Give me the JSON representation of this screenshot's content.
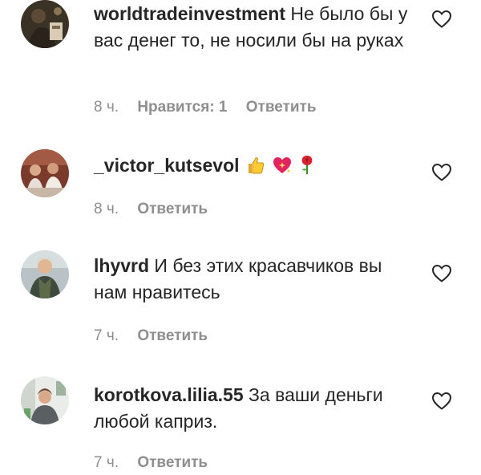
{
  "comments": [
    {
      "username": "worldtradeinvestment",
      "text": "Не было бы у вас денег то, не носили бы на руках",
      "time": "8 ч.",
      "likes_label": "Нравится: 1",
      "reply_label": "Ответить",
      "avatar_icon": "dark-photo-avatar"
    },
    {
      "username": "_victor_kutsevol",
      "text": "",
      "emojis": [
        "thumbs-up-icon",
        "sparkling-heart-icon",
        "rose-icon"
      ],
      "time": "8 ч.",
      "reply_label": "Ответить",
      "avatar_icon": "group-photo-avatar"
    },
    {
      "username": "lhyvrd",
      "text": "И без этих красавчиков вы нам нравитесь",
      "time": "7 ч.",
      "reply_label": "Ответить",
      "avatar_icon": "woman-photo-avatar"
    },
    {
      "username": "korotkova.lilia.55",
      "text": "За ваши деньги любой каприз.",
      "time": "7 ч.",
      "reply_label": "Ответить",
      "avatar_icon": "woman-indoor-photo-avatar"
    }
  ],
  "like_icon": "heart-outline-icon",
  "colors": {
    "text": "#262626",
    "meta": "#8e8e8e"
  }
}
